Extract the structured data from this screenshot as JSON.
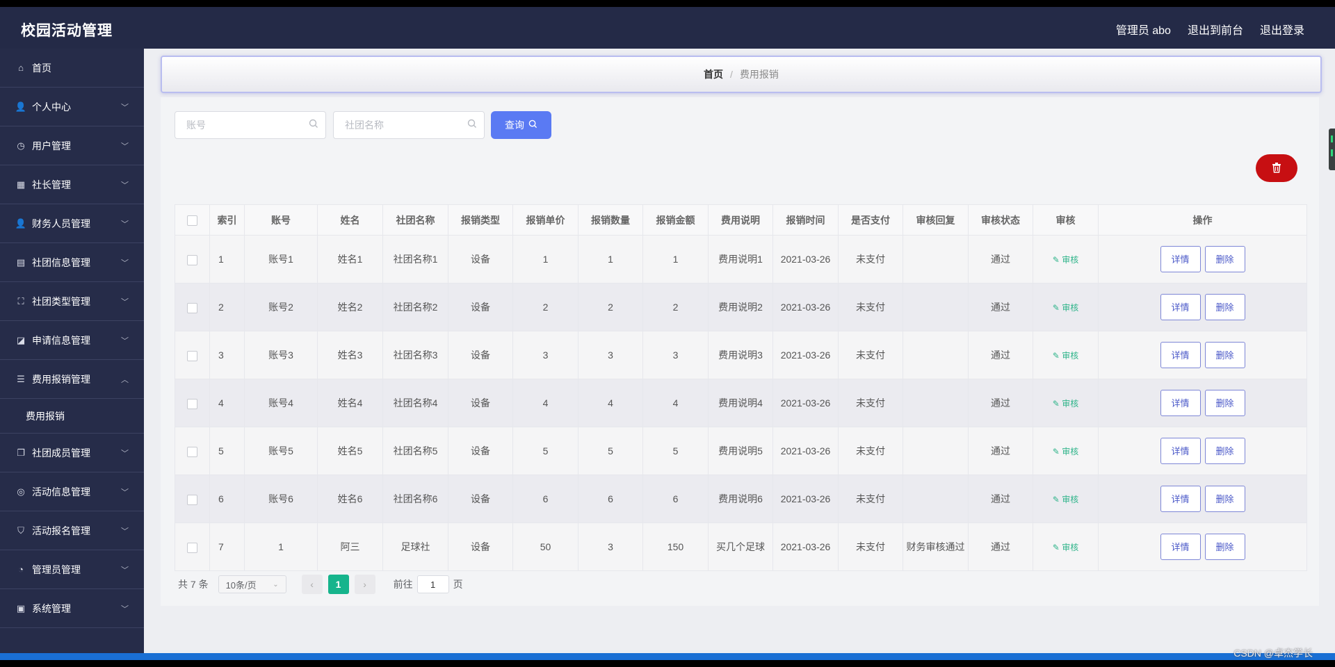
{
  "app": {
    "title": "校园活动管理"
  },
  "header": {
    "admin_label": "管理员 abo",
    "front_label": "退出到前台",
    "logout_label": "退出登录"
  },
  "sidebar": {
    "items": [
      {
        "label": "首页",
        "icon": "home-icon",
        "glyph": "⌂"
      },
      {
        "label": "个人中心",
        "icon": "person-icon",
        "glyph": "👤"
      },
      {
        "label": "用户管理",
        "icon": "dashboard-icon",
        "glyph": "◷"
      },
      {
        "label": "社长管理",
        "icon": "grid-icon",
        "glyph": "▦"
      },
      {
        "label": "财务人员管理",
        "icon": "person-icon",
        "glyph": "👤"
      },
      {
        "label": "社团信息管理",
        "icon": "clipboard-icon",
        "glyph": "▤"
      },
      {
        "label": "社团类型管理",
        "icon": "fullscreen-icon",
        "glyph": "⛶"
      },
      {
        "label": "申请信息管理",
        "icon": "chart-icon",
        "glyph": "◪"
      },
      {
        "label": "费用报销管理",
        "icon": "menu-icon",
        "glyph": "☰"
      },
      {
        "label": "社团成员管理",
        "icon": "copy-icon",
        "glyph": "❐"
      },
      {
        "label": "活动信息管理",
        "icon": "globe-icon",
        "glyph": "◎"
      },
      {
        "label": "活动报名管理",
        "icon": "stamp-icon",
        "glyph": "⛉"
      },
      {
        "label": "管理员管理",
        "icon": "compass-icon",
        "glyph": "◔"
      },
      {
        "label": "系统管理",
        "icon": "document-icon",
        "glyph": "▣"
      }
    ],
    "submenu_label": "费用报销"
  },
  "breadcrumb": {
    "home": "首页",
    "separator": "/",
    "current": "费用报销"
  },
  "search": {
    "account_placeholder": "账号",
    "club_placeholder": "社团名称",
    "query_label": "查询"
  },
  "table": {
    "headers": [
      "",
      "索引",
      "账号",
      "姓名",
      "社团名称",
      "报销类型",
      "报销单价",
      "报销数量",
      "报销金额",
      "费用说明",
      "报销时间",
      "是否支付",
      "审核回复",
      "审核状态",
      "审核",
      "操作"
    ],
    "audit_label": "审核",
    "detail_label": "详情",
    "delete_label": "删除",
    "rows": [
      {
        "index": "1",
        "account": "账号1",
        "name": "姓名1",
        "club": "社团名称1",
        "type": "设备",
        "price": "1",
        "qty": "1",
        "amount": "1",
        "desc": "费用说明1",
        "time": "2021-03-26",
        "paid": "未支付",
        "reply": "",
        "status": "通过"
      },
      {
        "index": "2",
        "account": "账号2",
        "name": "姓名2",
        "club": "社团名称2",
        "type": "设备",
        "price": "2",
        "qty": "2",
        "amount": "2",
        "desc": "费用说明2",
        "time": "2021-03-26",
        "paid": "未支付",
        "reply": "",
        "status": "通过"
      },
      {
        "index": "3",
        "account": "账号3",
        "name": "姓名3",
        "club": "社团名称3",
        "type": "设备",
        "price": "3",
        "qty": "3",
        "amount": "3",
        "desc": "费用说明3",
        "time": "2021-03-26",
        "paid": "未支付",
        "reply": "",
        "status": "通过"
      },
      {
        "index": "4",
        "account": "账号4",
        "name": "姓名4",
        "club": "社团名称4",
        "type": "设备",
        "price": "4",
        "qty": "4",
        "amount": "4",
        "desc": "费用说明4",
        "time": "2021-03-26",
        "paid": "未支付",
        "reply": "",
        "status": "通过"
      },
      {
        "index": "5",
        "account": "账号5",
        "name": "姓名5",
        "club": "社团名称5",
        "type": "设备",
        "price": "5",
        "qty": "5",
        "amount": "5",
        "desc": "费用说明5",
        "time": "2021-03-26",
        "paid": "未支付",
        "reply": "",
        "status": "通过"
      },
      {
        "index": "6",
        "account": "账号6",
        "name": "姓名6",
        "club": "社团名称6",
        "type": "设备",
        "price": "6",
        "qty": "6",
        "amount": "6",
        "desc": "费用说明6",
        "time": "2021-03-26",
        "paid": "未支付",
        "reply": "",
        "status": "通过"
      },
      {
        "index": "7",
        "account": "1",
        "name": "阿三",
        "club": "足球社",
        "type": "设备",
        "price": "50",
        "qty": "3",
        "amount": "150",
        "desc": "买几个足球",
        "time": "2021-03-26",
        "paid": "未支付",
        "reply": "财务审核通过",
        "status": "通过"
      }
    ]
  },
  "pagination": {
    "total": "共 7 条",
    "page_size": "10条/页",
    "current_page": "1",
    "goto_label": "前往",
    "goto_value": "1",
    "page_unit": "页"
  },
  "watermark": "CSDN @卓杰学长",
  "colors": {
    "header_bg": "#242a47",
    "sidebar_bg": "#262c49",
    "query_button": "#5a7af3",
    "delete_button": "#c70f12",
    "active_page": "#16b48c",
    "audit_link": "#2fb48a"
  }
}
